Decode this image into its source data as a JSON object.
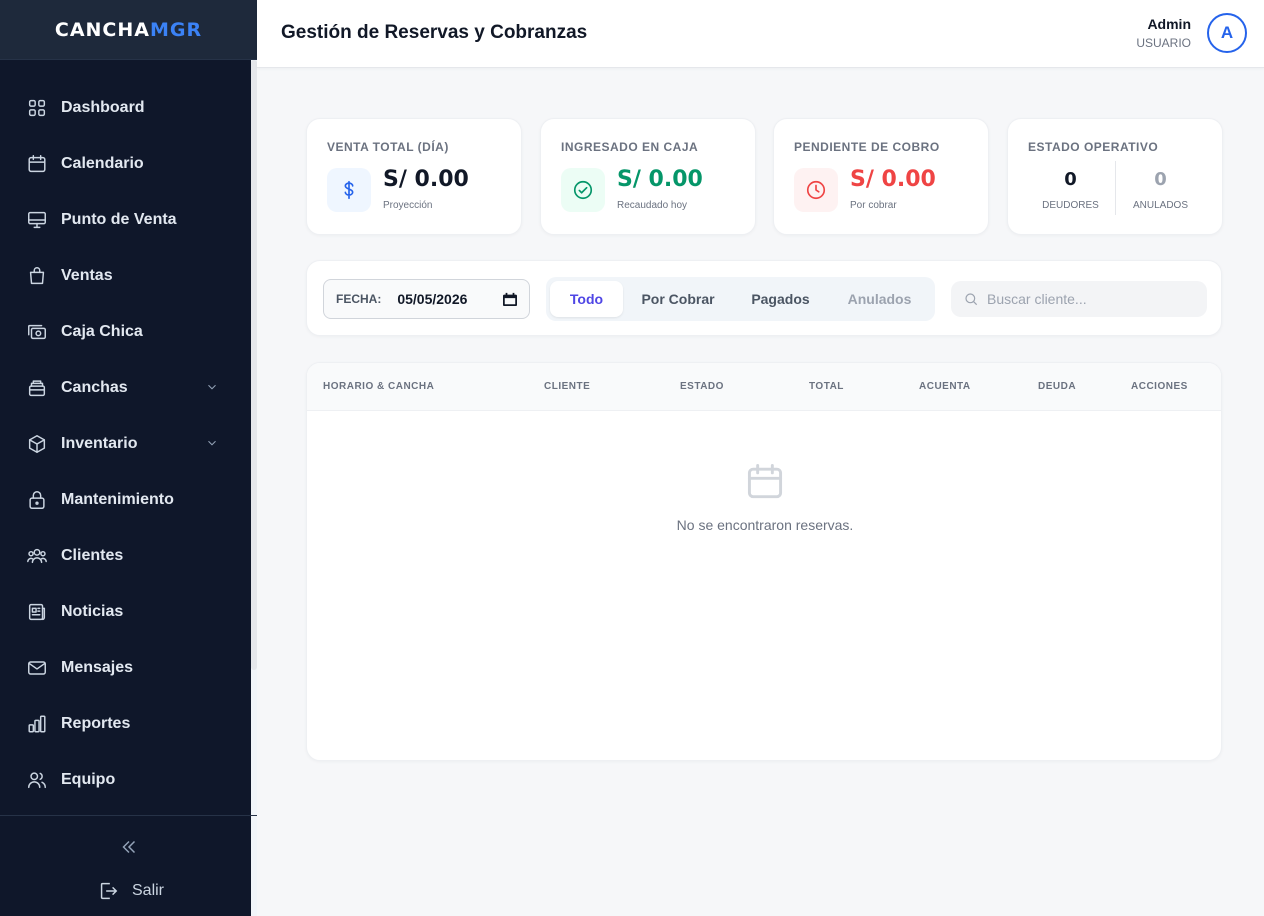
{
  "brand": {
    "part1": "CANCHA",
    "part2": "MGR"
  },
  "sidebar": {
    "items": [
      {
        "label": "Dashboard",
        "icon": "grid-icon"
      },
      {
        "label": "Calendario",
        "icon": "calendar-icon"
      },
      {
        "label": "Punto de Venta",
        "icon": "monitor-icon"
      },
      {
        "label": "Ventas",
        "icon": "shopping-bag-icon"
      },
      {
        "label": "Caja Chica",
        "icon": "cash-icon"
      },
      {
        "label": "Canchas",
        "icon": "layers-icon",
        "expandable": true
      },
      {
        "label": "Inventario",
        "icon": "box-icon",
        "expandable": true
      },
      {
        "label": "Mantenimiento",
        "icon": "lock-icon"
      },
      {
        "label": "Clientes",
        "icon": "users-icon"
      },
      {
        "label": "Noticias",
        "icon": "newspaper-icon"
      },
      {
        "label": "Mensajes",
        "icon": "mail-icon"
      },
      {
        "label": "Reportes",
        "icon": "bar-chart-icon"
      },
      {
        "label": "Equipo",
        "icon": "team-icon"
      }
    ],
    "logout_label": "Salir"
  },
  "header": {
    "title": "Gestión de Reservas y Cobranzas",
    "user_name": "Admin",
    "user_role": "USUARIO",
    "avatar_letter": "A"
  },
  "stats": {
    "venta_total": {
      "label": "VENTA TOTAL (DÍA)",
      "value": "S/ 0.00",
      "sub": "Proyección",
      "color": "#111827"
    },
    "ingresado": {
      "label": "INGRESADO EN CAJA",
      "value": "S/ 0.00",
      "sub": "Recaudado hoy",
      "color": "#059669"
    },
    "pendiente": {
      "label": "PENDIENTE DE COBRO",
      "value": "S/ 0.00",
      "sub": "Por cobrar",
      "color": "#ef4444"
    },
    "estado": {
      "label": "ESTADO OPERATIVO",
      "deudores_value": "0",
      "deudores_label": "DEUDORES",
      "anulados_value": "0",
      "anulados_label": "ANULADOS"
    }
  },
  "filters": {
    "date_label": "FECHA:",
    "date_value": "05/05/2026",
    "tabs": [
      "Todo",
      "Por Cobrar",
      "Pagados",
      "Anulados"
    ],
    "active_tab": "Todo",
    "search_placeholder": "Buscar cliente..."
  },
  "table": {
    "columns": [
      "HORARIO & CANCHA",
      "CLIENTE",
      "ESTADO",
      "TOTAL",
      "ACUENTA",
      "DEUDA",
      "ACCIONES"
    ],
    "empty_message": "No se encontraron reservas."
  },
  "colors": {
    "accent": "#4f46e5",
    "brand_blue": "#3b82f6",
    "sidebar_bg": "#0f172a"
  }
}
